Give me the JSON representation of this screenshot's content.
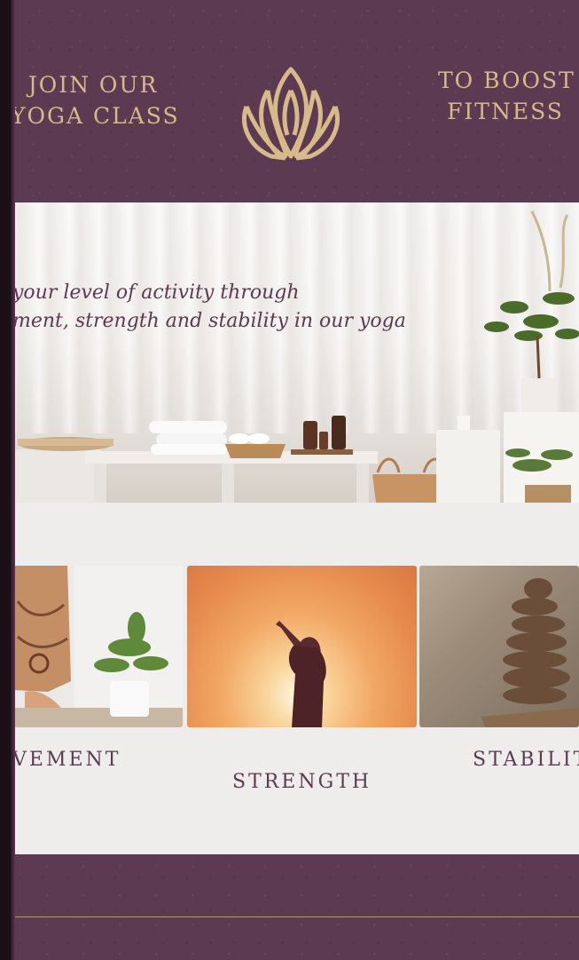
{
  "header": {
    "left_line1": "JOIN OUR",
    "left_line2": "YOGA CLASS",
    "right_line1": "TO BOOST",
    "right_line2": "FITNESS",
    "logo_icon": "lotus-icon",
    "accent_color": "#d8b98a",
    "bg_color": "#5c3a52"
  },
  "hero": {
    "line1": "your level  of activity through",
    "line2": "ment, strength and stability in our yoga"
  },
  "gallery": {
    "bg_color": "#efedeb",
    "cards": [
      {
        "caption": "VEMENT"
      },
      {
        "caption": "STRENGTH"
      },
      {
        "caption": "STABILITY"
      }
    ]
  },
  "footer": {
    "bg_color": "#5c3a52"
  }
}
